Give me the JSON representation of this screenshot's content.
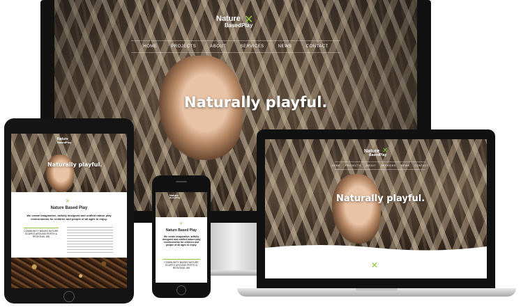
{
  "brand": {
    "line1": "Nature",
    "line2": "BasedPlay"
  },
  "nav": {
    "items": [
      "HOME",
      "PROJECTS",
      "ABOUT",
      "SERVICES",
      "NEWS",
      "CONTACT"
    ]
  },
  "hero": {
    "tagline": "Naturally playful."
  },
  "content": {
    "heading": "Nature Based Play",
    "intro": "We create imaginative, artfully designed and crafted nature play environments for children and people of all ages to enjoy.",
    "callout": "COMMUNITY BASED NATURE SCAPES AROUND PERTH & REGIONAL WA"
  },
  "colors": {
    "accent": "#8cc63f",
    "frame": "#111111"
  }
}
